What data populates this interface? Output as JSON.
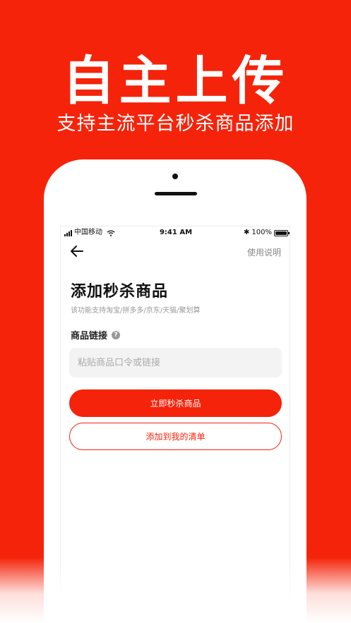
{
  "hero": {
    "title": "自主上传",
    "subtitle": "支持主流平台秒杀商品添加"
  },
  "status_bar": {
    "carrier": "中国移动",
    "time": "9:41 AM",
    "battery": "100%"
  },
  "nav": {
    "back_icon": "arrow-left-icon",
    "help_label": "使用说明"
  },
  "form": {
    "title": "添加秒杀商品",
    "description": "该功能支持淘宝/拼多多/京东/天猫/聚划算",
    "link_label": "商品链接",
    "help_icon_glyph": "?",
    "link_placeholder": "粘贴商品口令或链接",
    "link_value": ""
  },
  "actions": {
    "seckill_label": "立即秒杀商品",
    "add_list_label": "添加到我的清单"
  },
  "colors": {
    "brand_red": "#f5230a",
    "white": "#ffffff"
  }
}
